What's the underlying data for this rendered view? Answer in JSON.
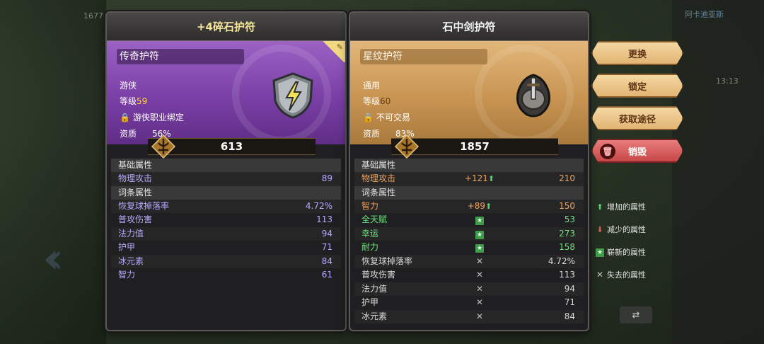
{
  "left_panel": {
    "title": "+4碎石护符",
    "rarity_label": "传奇护符",
    "class": "游侠",
    "level_label": "等级",
    "level": "59",
    "binding": "游侠职业绑定",
    "quality_label": "资质",
    "quality": "56%",
    "power": "613",
    "base_header": "基础属性",
    "base_attrs": [
      {
        "name": "物理攻击",
        "value": "89"
      }
    ],
    "affix_header": "词条属性",
    "affix_attrs": [
      {
        "name": "恢复球掉落率",
        "value": "4.72%"
      },
      {
        "name": "普攻伤害",
        "value": "113"
      },
      {
        "name": "法力值",
        "value": "94"
      },
      {
        "name": "护甲",
        "value": "71"
      },
      {
        "name": "冰元素",
        "value": "84"
      },
      {
        "name": "智力",
        "value": "61"
      }
    ]
  },
  "right_panel": {
    "title": "石中剑护符",
    "rarity_label": "星纹护符",
    "class": "通用",
    "level_label": "等级",
    "level": "60",
    "binding": "不可交易",
    "quality_label": "资质",
    "quality": "83%",
    "power": "1857",
    "base_header": "基础属性",
    "base_attrs": [
      {
        "name": "物理攻击",
        "diff": "+121",
        "value": "210"
      }
    ],
    "affix_header": "词条属性",
    "affix_attrs": [
      {
        "name": "智力",
        "diff": "+89",
        "value": "150"
      },
      {
        "name": "全天赋",
        "value": "53"
      },
      {
        "name": "幸运",
        "value": "273"
      },
      {
        "name": "耐力",
        "value": "158"
      },
      {
        "name": "恢复球掉落率",
        "value": "4.72%"
      },
      {
        "name": "普攻伤害",
        "value": "113"
      },
      {
        "name": "法力值",
        "value": "94"
      },
      {
        "name": "护甲",
        "value": "71"
      },
      {
        "name": "冰元素",
        "value": "84"
      }
    ]
  },
  "actions": {
    "replace": "更换",
    "lock": "锁定",
    "source": "获取途径",
    "destroy": "销毁"
  },
  "legend": {
    "increase": "增加的属性",
    "decrease": "减少的属性",
    "new": "崭新的属性",
    "lost": "失去的属性"
  },
  "hud": {
    "top_right_name": "阿卡迪亚斯",
    "top_left_num": "1677",
    "time": "13:13"
  },
  "colors": {
    "legendary": "#7a3fa6",
    "star": "#c89452",
    "increase": "#57d26a",
    "new": "#3f9c4a",
    "diff": "#f1a35e"
  }
}
